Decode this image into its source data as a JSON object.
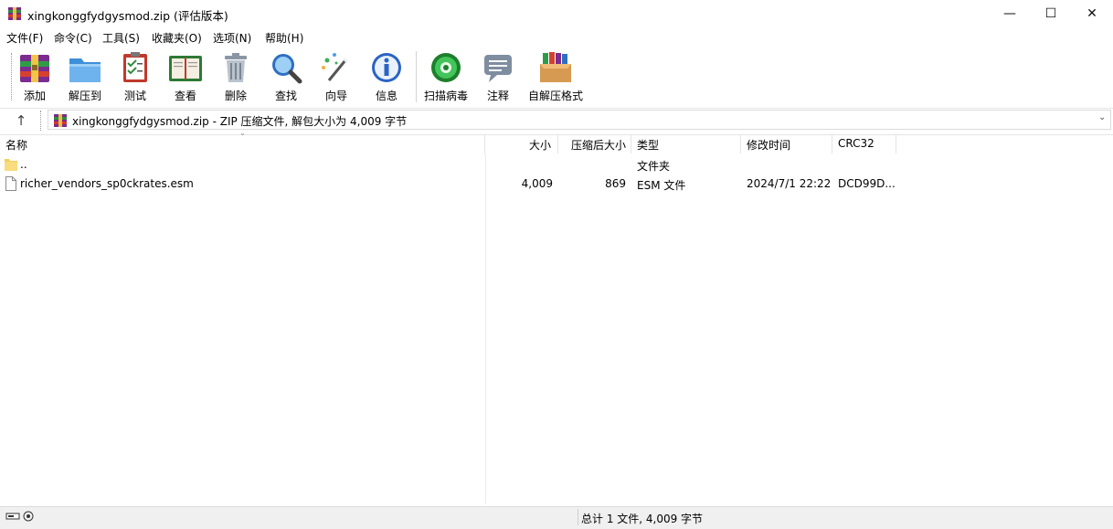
{
  "window": {
    "title": "xingkonggfydgysmod.zip (评估版本)",
    "controls": {
      "minimize": "—",
      "maximize": "☐",
      "close": "✕"
    }
  },
  "menu": [
    "文件(F)",
    "命令(C)",
    "工具(S)",
    "收藏夹(O)",
    "选项(N)",
    "帮助(H)"
  ],
  "toolbar": [
    {
      "label": "添加",
      "icon": "add-archive-icon"
    },
    {
      "label": "解压到",
      "icon": "extract-folder-icon"
    },
    {
      "label": "测试",
      "icon": "test-clipboard-icon"
    },
    {
      "label": "查看",
      "icon": "view-book-icon"
    },
    {
      "label": "删除",
      "icon": "trash-icon"
    },
    {
      "label": "查找",
      "icon": "magnifier-icon"
    },
    {
      "label": "向导",
      "icon": "wizard-wand-icon"
    },
    {
      "label": "信息",
      "icon": "info-icon"
    },
    {
      "label": "扫描病毒",
      "icon": "virus-scan-icon"
    },
    {
      "label": "注释",
      "icon": "comment-icon"
    },
    {
      "label": "自解压格式",
      "icon": "sfx-box-icon"
    }
  ],
  "address": {
    "up": "↑",
    "text": "xingkonggfydgysmod.zip - ZIP 压缩文件, 解包大小为 4,009 字节",
    "dropdown": "⌄"
  },
  "columns": {
    "name": "名称",
    "size": "大小",
    "packed": "压缩后大小",
    "type": "类型",
    "modified": "修改时间",
    "crc": "CRC32"
  },
  "files": [
    {
      "name": "..",
      "size": "",
      "packed": "",
      "type": "文件夹",
      "modified": "",
      "crc": ""
    },
    {
      "name": "richer_vendors_sp0ckrates.esm",
      "size": "4,009",
      "packed": "869",
      "type": "ESM 文件",
      "modified": "2024/7/1 22:22",
      "crc": "DCD99D..."
    }
  ],
  "status": {
    "summary": "总计 1 文件, 4,009 字节"
  },
  "colors": {
    "folder": "#f3cf5d",
    "accent_blue": "#1f6fc5",
    "status_bg": "#f0f0f0"
  }
}
